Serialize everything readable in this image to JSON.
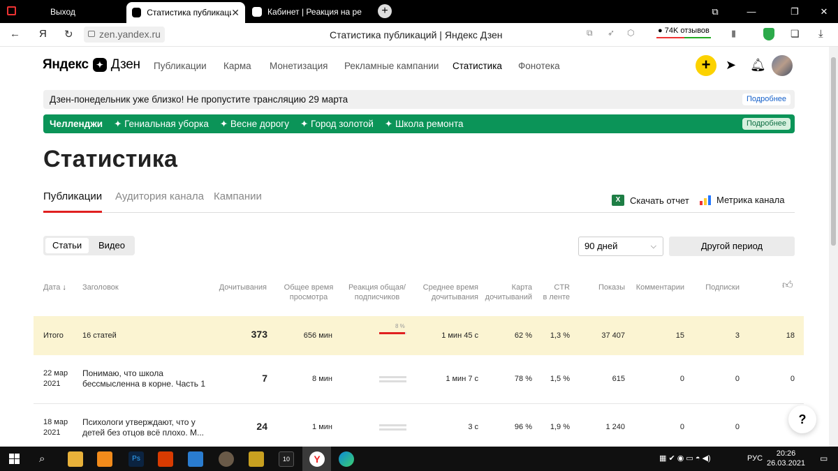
{
  "browser": {
    "tabs": [
      {
        "label": "Выход"
      },
      {
        "label": "Статистика публикаций"
      },
      {
        "label": "Кабинет | Реакция на ре"
      }
    ],
    "url": "zen.yandex.ru",
    "page_title": "Статистика публикаций | Яндекс Дзен",
    "reviews": "74K отзывов",
    "ya_letter": "Я"
  },
  "header": {
    "logo_a": "Яндекс",
    "logo_b": "Дзен",
    "nav": [
      "Публикации",
      "Карма",
      "Монетизация",
      "Рекламные кампании",
      "Статистика",
      "Фонотека"
    ]
  },
  "banner_info": {
    "text": "Дзен-понедельник уже близко! Не пропустите трансляцию 29 марта",
    "more": "Подробнее"
  },
  "banner_challenges": {
    "label": "Челленджи",
    "items": [
      "✦ Гениальная уборка",
      "✦ Весне дорогу",
      "✦ Город золотой",
      "✦ Школа ремонта"
    ],
    "more": "Подробнее"
  },
  "page": {
    "title": "Статистика"
  },
  "subtabs": [
    "Публикации",
    "Аудитория канала",
    "Кампании"
  ],
  "actions": {
    "download": "Скачать отчет",
    "metrika": "Метрика канала"
  },
  "segment": [
    "Статьи",
    "Видео"
  ],
  "period": {
    "value": "90 дней",
    "other": "Другой период"
  },
  "table": {
    "headers": {
      "date": "Дата",
      "title": "Заголовок",
      "reads": "Дочитывания",
      "time1": "Общее время",
      "time2": "просмотра",
      "react1": "Реакция общая/",
      "react2": "подписчиков",
      "avg1": "Среднее время",
      "avg2": "дочитывания",
      "card1": "Карта",
      "card2": "дочитываний",
      "ctr1": "CTR",
      "ctr2": "в ленте",
      "shows": "Показы",
      "comments": "Комментарии",
      "subs": "Подписки"
    },
    "total": {
      "label": "Итого",
      "title": "16 статей",
      "reads": "373",
      "time": "656 мин",
      "react_pct": "8 %",
      "avg": "1 мин 45 с",
      "card": "62 %",
      "ctr": "1,3 %",
      "shows": "37 407",
      "comments": "15",
      "subs": "3",
      "likes": "18"
    },
    "rows": [
      {
        "date1": "22 мар",
        "date2": "2021",
        "t1": "Понимаю, что школа",
        "t2": "бессмысленна в корне. Часть 1",
        "reads": "7",
        "time": "8 мин",
        "avg": "1 мин 7 с",
        "card": "78 %",
        "ctr": "1,5 %",
        "shows": "615",
        "comments": "0",
        "subs": "0",
        "likes": "0"
      },
      {
        "date1": "18 мар",
        "date2": "2021",
        "t1": "Психологи утверждают, что у",
        "t2": "детей без отцов всё плохо. М...",
        "reads": "24",
        "time": "1 мин",
        "avg": "3 с",
        "card": "96 %",
        "ctr": "1,9 %",
        "shows": "1 240",
        "comments": "0",
        "subs": "0",
        "likes": ""
      }
    ]
  },
  "help": "?",
  "taskbar": {
    "lang": "РУС",
    "time": "20:26",
    "date": "26.03.2021"
  }
}
